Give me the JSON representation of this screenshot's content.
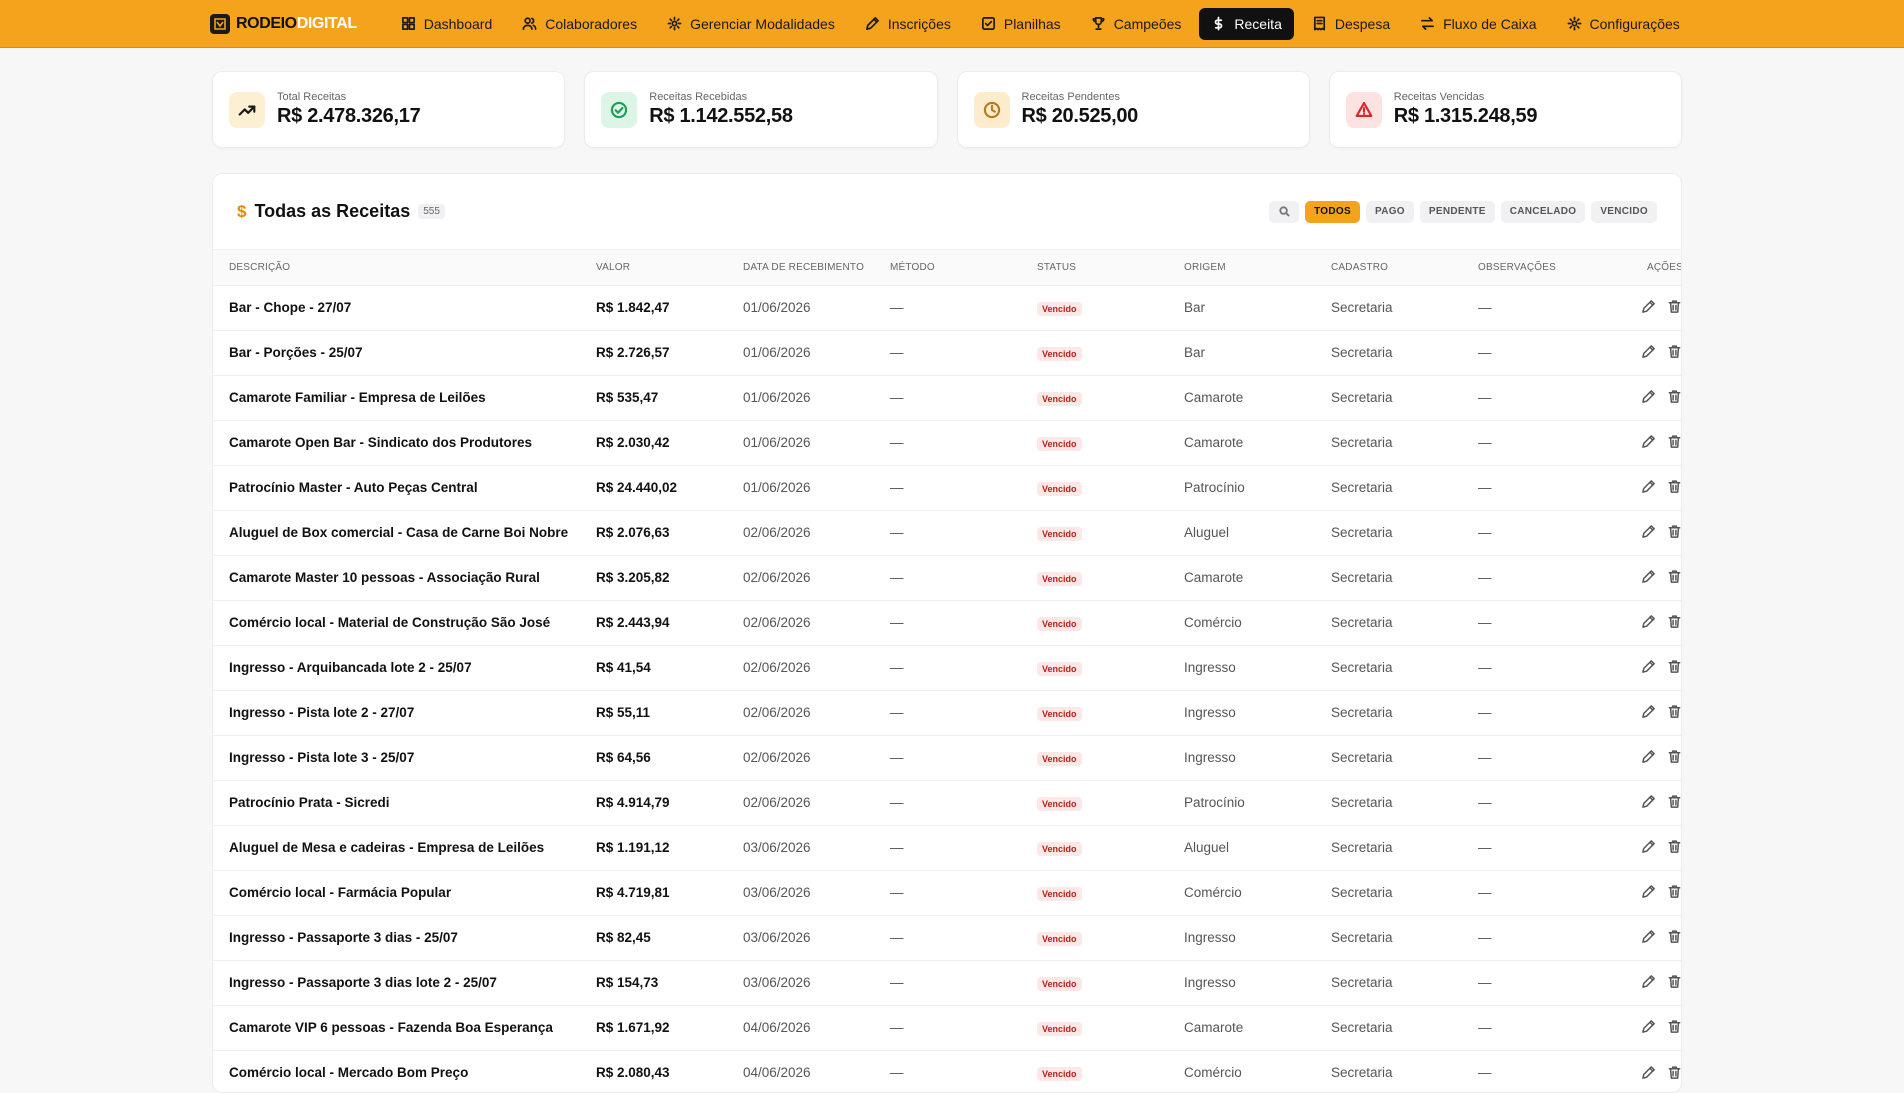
{
  "brand": {
    "part1": "RODEIO",
    "part2": "DIGITAL"
  },
  "nav": [
    {
      "label": "Dashboard",
      "icon": "grid-icon",
      "active": false
    },
    {
      "label": "Colaboradores",
      "icon": "users-icon",
      "active": false
    },
    {
      "label": "Gerenciar Modalidades",
      "icon": "gear-icon",
      "active": false
    },
    {
      "label": "Inscrições",
      "icon": "pen-icon",
      "active": false
    },
    {
      "label": "Planilhas",
      "icon": "checklist-icon",
      "active": false
    },
    {
      "label": "Campeões",
      "icon": "trophy-icon",
      "active": false
    },
    {
      "label": "Receita",
      "icon": "dollar-icon",
      "active": true
    },
    {
      "label": "Despesa",
      "icon": "receipt-icon",
      "active": false
    },
    {
      "label": "Fluxo de Caixa",
      "icon": "arrows-icon",
      "active": false
    },
    {
      "label": "Configurações",
      "icon": "gear-icon",
      "active": false
    }
  ],
  "stats": [
    {
      "label": "Total Receitas",
      "value": "R$ 2.478.326,17",
      "icon": "trending-up-icon",
      "bg": "#fdf0d2",
      "color": "#1a1a1a"
    },
    {
      "label": "Receitas Recebidas",
      "value": "R$ 1.142.552,58",
      "icon": "check-circle-icon",
      "bg": "#dcf5e6",
      "color": "#1f9d57"
    },
    {
      "label": "Receitas Pendentes",
      "value": "R$ 20.525,00",
      "icon": "clock-icon",
      "bg": "#fdeccb",
      "color": "#b7791f"
    },
    {
      "label": "Receitas Vencidas",
      "value": "R$ 1.315.248,59",
      "icon": "alert-triangle-icon",
      "bg": "#fde2e2",
      "color": "#dc2626"
    }
  ],
  "table": {
    "title": "Todas as Receitas",
    "count": "555",
    "filters": [
      {
        "label": "TODOS",
        "active": true
      },
      {
        "label": "PAGO",
        "active": false
      },
      {
        "label": "PENDENTE",
        "active": false
      },
      {
        "label": "CANCELADO",
        "active": false
      },
      {
        "label": "VENCIDO",
        "active": false
      }
    ],
    "columns": [
      "Descrição",
      "Valor",
      "Data de recebimento",
      "Método",
      "Status",
      "Origem",
      "Cadastro",
      "Observações",
      "Ações"
    ],
    "rows": [
      {
        "descricao": "Bar - Chope - 27/07",
        "valor": "R$ 1.842,47",
        "data": "01/06/2026",
        "metodo": "—",
        "status": "Vencido",
        "origem": "Bar",
        "cadastro": "Secretaria",
        "obs": "—"
      },
      {
        "descricao": "Bar - Porções - 25/07",
        "valor": "R$ 2.726,57",
        "data": "01/06/2026",
        "metodo": "—",
        "status": "Vencido",
        "origem": "Bar",
        "cadastro": "Secretaria",
        "obs": "—"
      },
      {
        "descricao": "Camarote Familiar - Empresa de Leilões",
        "valor": "R$ 535,47",
        "data": "01/06/2026",
        "metodo": "—",
        "status": "Vencido",
        "origem": "Camarote",
        "cadastro": "Secretaria",
        "obs": "—"
      },
      {
        "descricao": "Camarote Open Bar - Sindicato dos Produtores",
        "valor": "R$ 2.030,42",
        "data": "01/06/2026",
        "metodo": "—",
        "status": "Vencido",
        "origem": "Camarote",
        "cadastro": "Secretaria",
        "obs": "—"
      },
      {
        "descricao": "Patrocínio Master - Auto Peças Central",
        "valor": "R$ 24.440,02",
        "data": "01/06/2026",
        "metodo": "—",
        "status": "Vencido",
        "origem": "Patrocínio",
        "cadastro": "Secretaria",
        "obs": "—"
      },
      {
        "descricao": "Aluguel de Box comercial - Casa de Carne Boi Nobre",
        "valor": "R$ 2.076,63",
        "data": "02/06/2026",
        "metodo": "—",
        "status": "Vencido",
        "origem": "Aluguel",
        "cadastro": "Secretaria",
        "obs": "—"
      },
      {
        "descricao": "Camarote Master 10 pessoas - Associação Rural",
        "valor": "R$ 3.205,82",
        "data": "02/06/2026",
        "metodo": "—",
        "status": "Vencido",
        "origem": "Camarote",
        "cadastro": "Secretaria",
        "obs": "—"
      },
      {
        "descricao": "Comércio local - Material de Construção São José",
        "valor": "R$ 2.443,94",
        "data": "02/06/2026",
        "metodo": "—",
        "status": "Vencido",
        "origem": "Comércio",
        "cadastro": "Secretaria",
        "obs": "—"
      },
      {
        "descricao": "Ingresso - Arquibancada lote 2 - 25/07",
        "valor": "R$ 41,54",
        "data": "02/06/2026",
        "metodo": "—",
        "status": "Vencido",
        "origem": "Ingresso",
        "cadastro": "Secretaria",
        "obs": "—"
      },
      {
        "descricao": "Ingresso - Pista lote 2 - 27/07",
        "valor": "R$ 55,11",
        "data": "02/06/2026",
        "metodo": "—",
        "status": "Vencido",
        "origem": "Ingresso",
        "cadastro": "Secretaria",
        "obs": "—"
      },
      {
        "descricao": "Ingresso - Pista lote 3 - 25/07",
        "valor": "R$ 64,56",
        "data": "02/06/2026",
        "metodo": "—",
        "status": "Vencido",
        "origem": "Ingresso",
        "cadastro": "Secretaria",
        "obs": "—"
      },
      {
        "descricao": "Patrocínio Prata - Sicredi",
        "valor": "R$ 4.914,79",
        "data": "02/06/2026",
        "metodo": "—",
        "status": "Vencido",
        "origem": "Patrocínio",
        "cadastro": "Secretaria",
        "obs": "—"
      },
      {
        "descricao": "Aluguel de Mesa e cadeiras - Empresa de Leilões",
        "valor": "R$ 1.191,12",
        "data": "03/06/2026",
        "metodo": "—",
        "status": "Vencido",
        "origem": "Aluguel",
        "cadastro": "Secretaria",
        "obs": "—"
      },
      {
        "descricao": "Comércio local - Farmácia Popular",
        "valor": "R$ 4.719,81",
        "data": "03/06/2026",
        "metodo": "—",
        "status": "Vencido",
        "origem": "Comércio",
        "cadastro": "Secretaria",
        "obs": "—"
      },
      {
        "descricao": "Ingresso - Passaporte 3 dias - 25/07",
        "valor": "R$ 82,45",
        "data": "03/06/2026",
        "metodo": "—",
        "status": "Vencido",
        "origem": "Ingresso",
        "cadastro": "Secretaria",
        "obs": "—"
      },
      {
        "descricao": "Ingresso - Passaporte 3 dias lote 2 - 25/07",
        "valor": "R$ 154,73",
        "data": "03/06/2026",
        "metodo": "—",
        "status": "Vencido",
        "origem": "Ingresso",
        "cadastro": "Secretaria",
        "obs": "—"
      },
      {
        "descricao": "Camarote VIP 6 pessoas - Fazenda Boa Esperança",
        "valor": "R$ 1.671,92",
        "data": "04/06/2026",
        "metodo": "—",
        "status": "Vencido",
        "origem": "Camarote",
        "cadastro": "Secretaria",
        "obs": "—"
      },
      {
        "descricao": "Comércio local - Mercado Bom Preço",
        "valor": "R$ 2.080,43",
        "data": "04/06/2026",
        "metodo": "—",
        "status": "Vencido",
        "origem": "Comércio",
        "cadastro": "Secretaria",
        "obs": "—"
      }
    ]
  }
}
